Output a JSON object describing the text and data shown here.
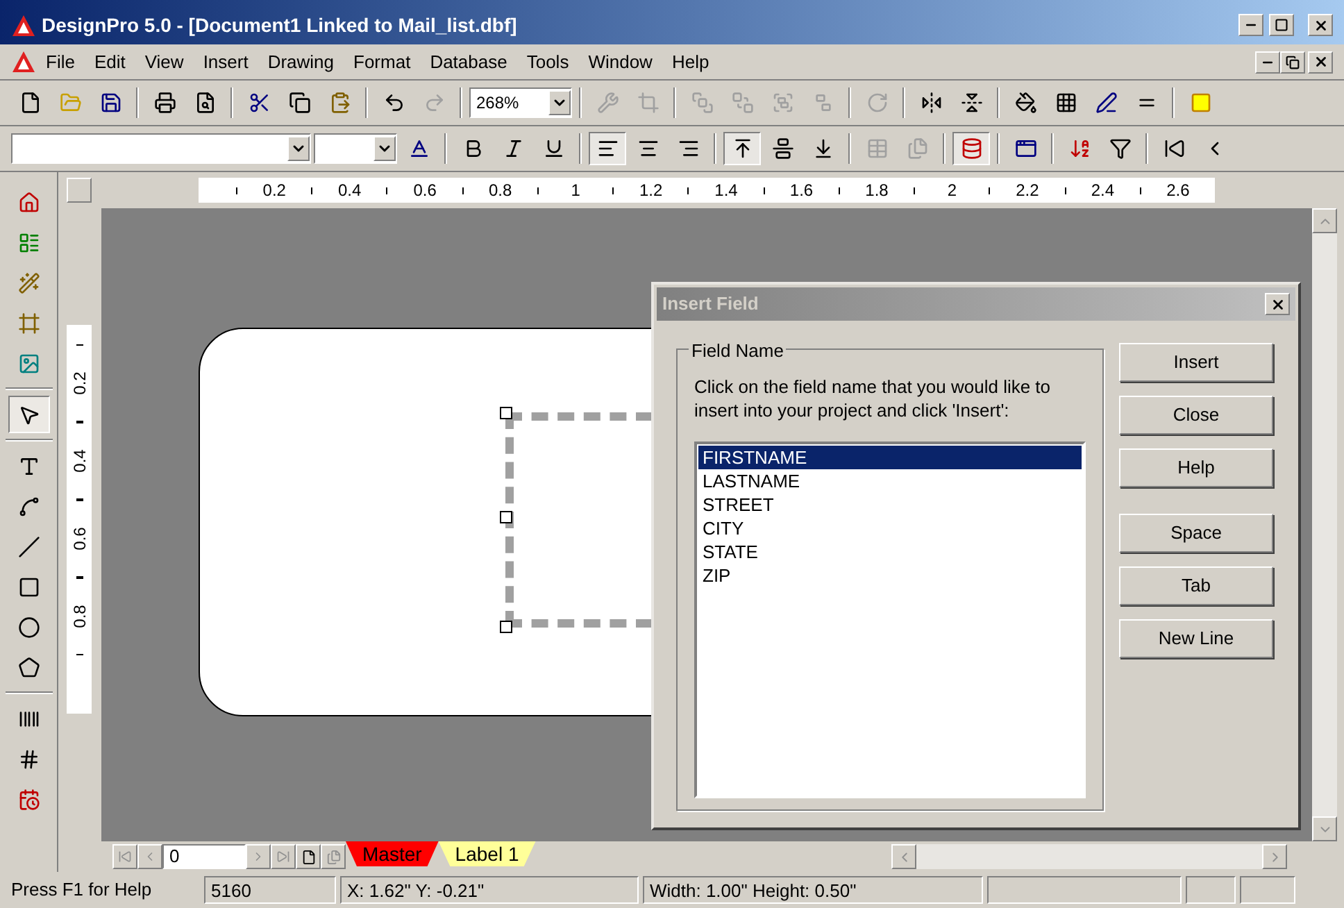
{
  "window": {
    "title": "DesignPro 5.0 - [Document1 Linked to Mail_list.dbf]"
  },
  "menu": [
    "File",
    "Edit",
    "View",
    "Insert",
    "Drawing",
    "Format",
    "Database",
    "Tools",
    "Window",
    "Help"
  ],
  "toolbar_1": [
    {
      "kind": "new"
    },
    {
      "kind": "open"
    },
    {
      "kind": "save"
    },
    {
      "kind": "sep"
    },
    {
      "kind": "print"
    },
    {
      "kind": "preview"
    },
    {
      "kind": "sep"
    },
    {
      "kind": "cut"
    },
    {
      "kind": "copy"
    },
    {
      "kind": "paste"
    },
    {
      "kind": "sep"
    },
    {
      "kind": "undo"
    },
    {
      "kind": "redo",
      "disabled": true
    },
    {
      "kind": "sep"
    },
    {
      "kind": "zoom",
      "value": "268%"
    },
    {
      "kind": "sep"
    },
    {
      "kind": "tools",
      "disabled": true
    },
    {
      "kind": "crop",
      "disabled": true
    },
    {
      "kind": "sep"
    },
    {
      "kind": "front",
      "disabled": true
    },
    {
      "kind": "back",
      "disabled": true
    },
    {
      "kind": "group",
      "disabled": true
    },
    {
      "kind": "ungroup",
      "disabled": true
    },
    {
      "kind": "sep"
    },
    {
      "kind": "rotate",
      "disabled": true
    },
    {
      "kind": "sep"
    },
    {
      "kind": "fliph"
    },
    {
      "kind": "flipv"
    },
    {
      "kind": "sep"
    },
    {
      "kind": "fill"
    },
    {
      "kind": "pattern"
    },
    {
      "kind": "pen"
    },
    {
      "kind": "linewidth"
    },
    {
      "kind": "sep"
    },
    {
      "kind": "color"
    }
  ],
  "toolbar_2": [
    {
      "kind": "font"
    },
    {
      "kind": "size"
    },
    {
      "kind": "fontcolor"
    },
    {
      "kind": "sep"
    },
    {
      "kind": "bold"
    },
    {
      "kind": "italic"
    },
    {
      "kind": "underline"
    },
    {
      "kind": "sep"
    },
    {
      "kind": "alignleft",
      "pressed": true
    },
    {
      "kind": "aligncenter",
      "pressed": false
    },
    {
      "kind": "alignright",
      "pressed": false
    },
    {
      "kind": "sep"
    },
    {
      "kind": "valigntop",
      "pressed": true
    },
    {
      "kind": "valignmiddle",
      "pressed": false
    },
    {
      "kind": "valignbottom",
      "pressed": false
    },
    {
      "kind": "sep"
    },
    {
      "kind": "table",
      "disabled": true
    },
    {
      "kind": "merge",
      "disabled": true
    },
    {
      "kind": "sep"
    },
    {
      "kind": "dblink",
      "pressed": true
    },
    {
      "kind": "sep"
    },
    {
      "kind": "browse",
      "pressed": false
    },
    {
      "kind": "sep"
    },
    {
      "kind": "sort"
    },
    {
      "kind": "filter"
    },
    {
      "kind": "sep"
    },
    {
      "kind": "first"
    },
    {
      "kind": "prev"
    }
  ],
  "tools": [
    {
      "kind": "home"
    },
    {
      "kind": "layout"
    },
    {
      "kind": "wizard"
    },
    {
      "kind": "picture"
    },
    {
      "kind": "image"
    },
    {
      "kind": "sep"
    },
    {
      "kind": "pointer",
      "selected": true
    },
    {
      "kind": "sep"
    },
    {
      "kind": "textbox",
      "selected": false
    },
    {
      "kind": "arctext",
      "selected": false
    },
    {
      "kind": "line",
      "selected": false
    },
    {
      "kind": "rect",
      "selected": false
    },
    {
      "kind": "ellipse",
      "selected": false
    },
    {
      "kind": "polygon",
      "selected": false
    },
    {
      "kind": "sep"
    },
    {
      "kind": "barcode",
      "selected": false
    },
    {
      "kind": "counter",
      "selected": false
    },
    {
      "kind": "date",
      "selected": false
    }
  ],
  "ruler_horizontal": [
    "0.2",
    "0.4",
    "0.6",
    "0.8",
    "1",
    "1.2",
    "1.4",
    "1.6",
    "1.8",
    "2",
    "2.2",
    "2.4",
    "2.6"
  ],
  "ruler_vertical": [
    "0.2",
    "0.4",
    "0.6",
    "0.8"
  ],
  "dialog": {
    "title": "Insert Field",
    "group_label": "Field Name",
    "instruction": "Click on the field name that you would like to insert into your project and click 'Insert':",
    "fields": [
      {
        "name": "FIRSTNAME",
        "selected": true
      },
      {
        "name": "LASTNAME",
        "selected": false
      },
      {
        "name": "STREET",
        "selected": false
      },
      {
        "name": "CITY",
        "selected": false
      },
      {
        "name": "STATE",
        "selected": false
      },
      {
        "name": "ZIP",
        "selected": false
      }
    ],
    "buttons": [
      "Insert",
      "Close",
      "Help"
    ],
    "insert_buttons": [
      "Space",
      "Tab",
      "New Line"
    ]
  },
  "page_number": "0",
  "tabs": [
    {
      "label": "Master",
      "color": "#ff0000"
    },
    {
      "label": "Label 1",
      "color": "#ffff99"
    }
  ],
  "status_bar": [
    "Press F1 for Help",
    "5160",
    "X: 1.62\"   Y: -0.21\"",
    "Width: 1.00\"   Height: 0.50\""
  ]
}
